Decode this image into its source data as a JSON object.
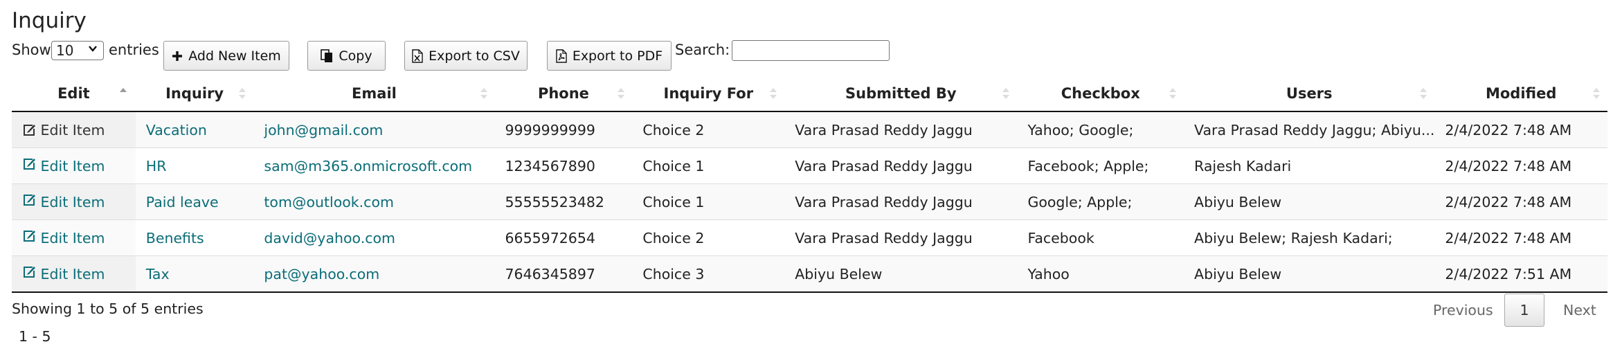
{
  "page": {
    "title": "Inquiry"
  },
  "toolbar": {
    "show_label": "Show",
    "page_size": "10",
    "entries_label": "entries",
    "add_label": "Add New Item",
    "copy_label": "Copy",
    "csv_label": "Export to CSV",
    "pdf_label": "Export to PDF",
    "search_label": "Search:",
    "search_value": ""
  },
  "table": {
    "columns": [
      "Edit",
      "Inquiry",
      "Email",
      "Phone",
      "Inquiry For",
      "Submitted By",
      "Checkbox",
      "Users",
      "Modified"
    ],
    "rows": [
      {
        "edit": "Edit Item",
        "inquiry": "Vacation",
        "email": "john@gmail.com",
        "phone": "9999999999",
        "inquiry_for": "Choice 2",
        "submitted_by": "Vara Prasad Reddy Jaggu",
        "checkbox": "Yahoo; Google;",
        "users": "Vara Prasad Reddy Jaggu; Abiyu...",
        "modified": "2/4/2022 7:48 AM"
      },
      {
        "edit": "Edit Item",
        "inquiry": "HR",
        "email": "sam@m365.onmicrosoft.com",
        "phone": "1234567890",
        "inquiry_for": "Choice 1",
        "submitted_by": "Vara Prasad Reddy Jaggu",
        "checkbox": "Facebook; Apple;",
        "users": "Rajesh Kadari",
        "modified": "2/4/2022 7:48 AM"
      },
      {
        "edit": "Edit Item",
        "inquiry": "Paid leave",
        "email": "tom@outlook.com",
        "phone": "55555523482",
        "inquiry_for": "Choice 1",
        "submitted_by": "Vara Prasad Reddy Jaggu",
        "checkbox": "Google; Apple;",
        "users": "Abiyu Belew",
        "modified": "2/4/2022 7:48 AM"
      },
      {
        "edit": "Edit Item",
        "inquiry": "Benefits",
        "email": "david@yahoo.com",
        "phone": "6655972654",
        "inquiry_for": "Choice 2",
        "submitted_by": "Vara Prasad Reddy Jaggu",
        "checkbox": "Facebook",
        "users": "Abiyu Belew; Rajesh Kadari;",
        "modified": "2/4/2022 7:48 AM"
      },
      {
        "edit": "Edit Item",
        "inquiry": "Tax",
        "email": "pat@yahoo.com",
        "phone": "7646345897",
        "inquiry_for": "Choice 3",
        "submitted_by": "Abiyu Belew",
        "checkbox": "Yahoo",
        "users": "Abiyu Belew",
        "modified": "2/4/2022 7:51 AM"
      }
    ]
  },
  "footer": {
    "info": "Showing 1 to 5 of 5 entries",
    "range": "1 - 5",
    "previous_label": "Previous",
    "current_page": "1",
    "next_label": "Next"
  },
  "colors": {
    "link": "#0b6d78",
    "header_rule": "#111111",
    "stripe": "#f9f9f9"
  },
  "icons": [
    "chevron-down-icon",
    "plus-icon",
    "copy-icon",
    "csv-file-icon",
    "pdf-file-icon",
    "edit-icon",
    "sort-icon"
  ]
}
